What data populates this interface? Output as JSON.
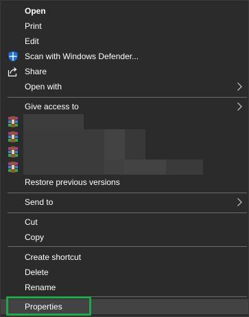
{
  "menu": {
    "items": [
      {
        "label": "Open"
      },
      {
        "label": "Print"
      },
      {
        "label": "Edit"
      },
      {
        "label": "Scan with Windows Defender..."
      },
      {
        "label": "Share"
      },
      {
        "label": "Open with"
      },
      {
        "label": "Give access to"
      },
      {
        "label": "Restore previous versions"
      },
      {
        "label": "Send to"
      },
      {
        "label": "Cut"
      },
      {
        "label": "Copy"
      },
      {
        "label": "Create shortcut"
      },
      {
        "label": "Delete"
      },
      {
        "label": "Rename"
      },
      {
        "label": "Properties"
      }
    ],
    "icons": {
      "defender": "windows-defender-shield-icon",
      "share": "share-icon",
      "archive": "winrar-archive-icon",
      "submenu": "chevron-right-icon"
    },
    "colors": {
      "background": "#2b2b2b",
      "text": "#ffffff",
      "separator": "#6a6a6a",
      "hover": "#434343",
      "focus_outline": "#1fa84a",
      "defender_blue": "#1e6fd9"
    }
  }
}
